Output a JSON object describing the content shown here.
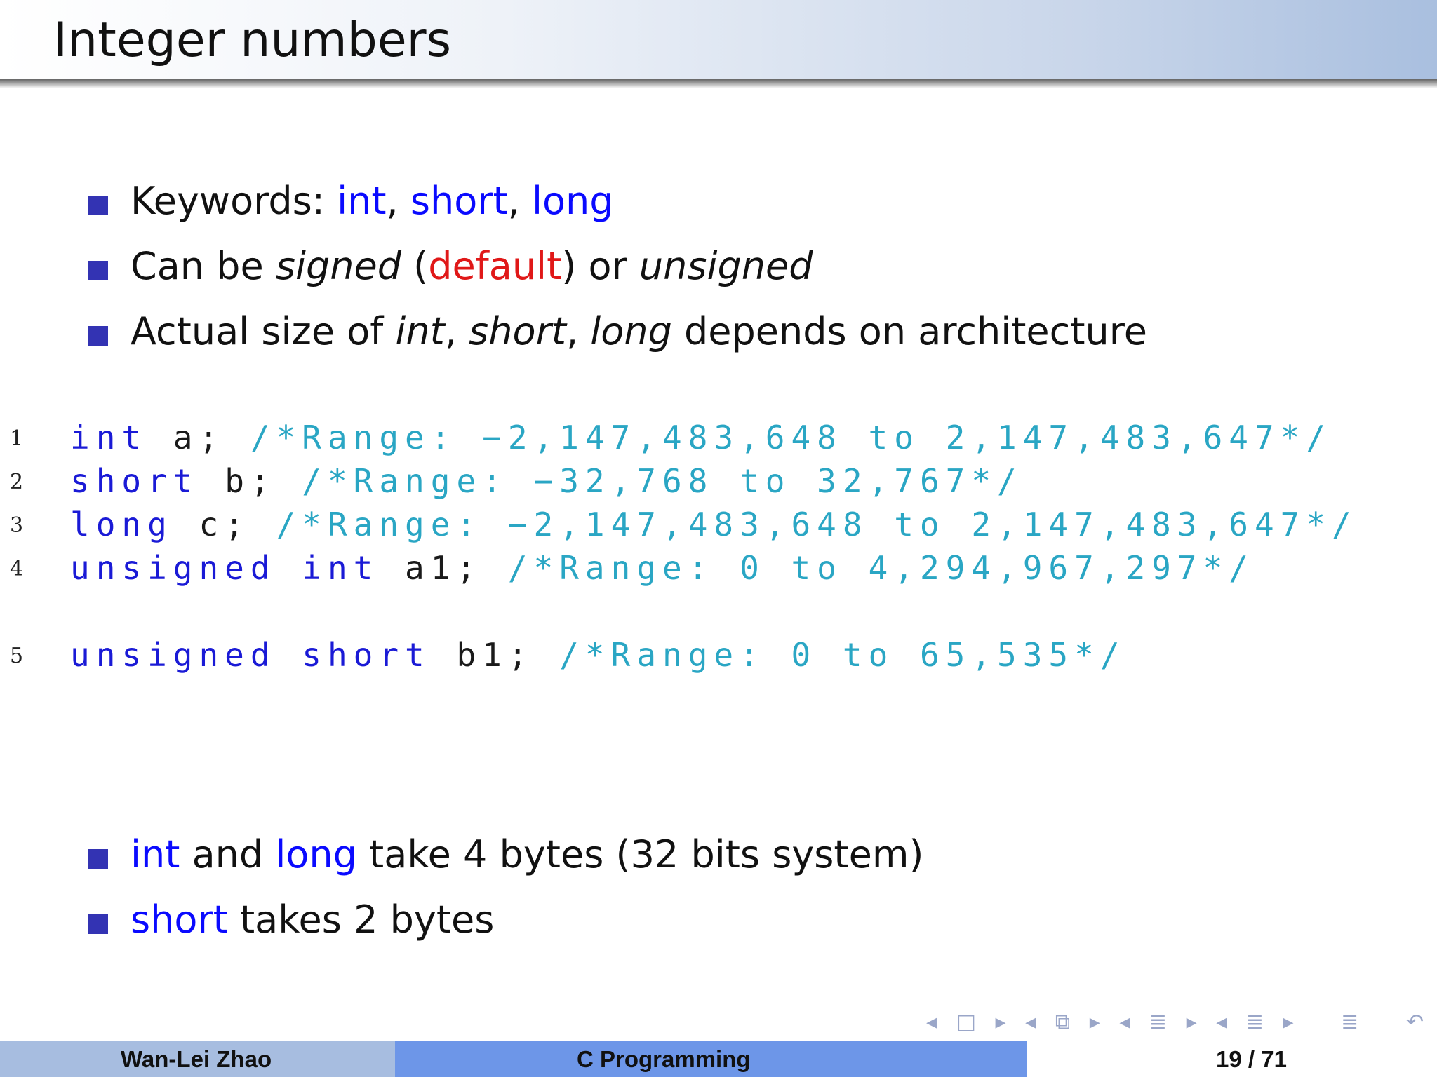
{
  "slide": {
    "title": "Integer numbers"
  },
  "bullets_top": [
    {
      "parts": [
        {
          "text": "Keywords: ",
          "style": "normal"
        },
        {
          "text": "int",
          "style": "kw"
        },
        {
          "text": ", ",
          "style": "normal"
        },
        {
          "text": "short",
          "style": "kw"
        },
        {
          "text": ", ",
          "style": "normal"
        },
        {
          "text": "long",
          "style": "kw"
        }
      ]
    },
    {
      "parts": [
        {
          "text": "Can be ",
          "style": "normal"
        },
        {
          "text": "signed",
          "style": "em"
        },
        {
          "text": " (",
          "style": "normal"
        },
        {
          "text": "default",
          "style": "red"
        },
        {
          "text": ") or ",
          "style": "normal"
        },
        {
          "text": "unsigned",
          "style": "em"
        }
      ]
    },
    {
      "parts": [
        {
          "text": "Actual size of ",
          "style": "normal"
        },
        {
          "text": "int",
          "style": "em"
        },
        {
          "text": ", ",
          "style": "normal"
        },
        {
          "text": "short",
          "style": "em"
        },
        {
          "text": ", ",
          "style": "normal"
        },
        {
          "text": "long",
          "style": "em"
        },
        {
          "text": " depends on architecture",
          "style": "normal"
        }
      ]
    }
  ],
  "code": [
    {
      "num": "1",
      "keyword": "int",
      "ident": "a;",
      "comment": "/*Range: −2,147,483,648 to 2,147,483,647*/"
    },
    {
      "num": "2",
      "keyword": "short",
      "ident": "b;",
      "comment": "/*Range: −32,768 to 32,767*/"
    },
    {
      "num": "3",
      "keyword": "long",
      "ident": "c;",
      "comment": "/*Range: −2,147,483,648 to 2,147,483,647*/"
    },
    {
      "num": "4",
      "keyword": "unsigned int",
      "ident": "a1;",
      "comment": "/*Range: 0 to 4,294,967,297*/"
    },
    {
      "num": "5",
      "keyword": "unsigned short",
      "ident": "b1;",
      "comment": "/*Range: 0 to 65,535*/"
    }
  ],
  "bullets_bottom": [
    {
      "parts": [
        {
          "text": "int",
          "style": "kw"
        },
        {
          "text": " and ",
          "style": "normal"
        },
        {
          "text": "long",
          "style": "kw"
        },
        {
          "text": " take 4 bytes (32 bits system)",
          "style": "normal"
        }
      ]
    },
    {
      "parts": [
        {
          "text": "short",
          "style": "kw"
        },
        {
          "text": " takes 2 bytes",
          "style": "normal"
        }
      ]
    }
  ],
  "footer": {
    "author": "Wan-Lei Zhao",
    "course": "C Programming",
    "page": "19 / 71"
  },
  "nav_icons": [
    "prev-slide-icon",
    "frame-icon",
    "next-slide-icon",
    "prev-subsection-icon",
    "outline-icon",
    "next-subsection-icon",
    "prev-section-icon",
    "section-icon",
    "next-section-icon",
    "align-icon",
    "search-icon",
    "undo-icon"
  ],
  "colors": {
    "keyword": "#0a0aff",
    "default_highlight": "#e01818",
    "code_keyword": "#1a1ad6",
    "code_comment": "#2aa6c4",
    "bullet": "#3333b3",
    "footer_left": "#a7bde0",
    "footer_mid": "#6d96e8"
  }
}
